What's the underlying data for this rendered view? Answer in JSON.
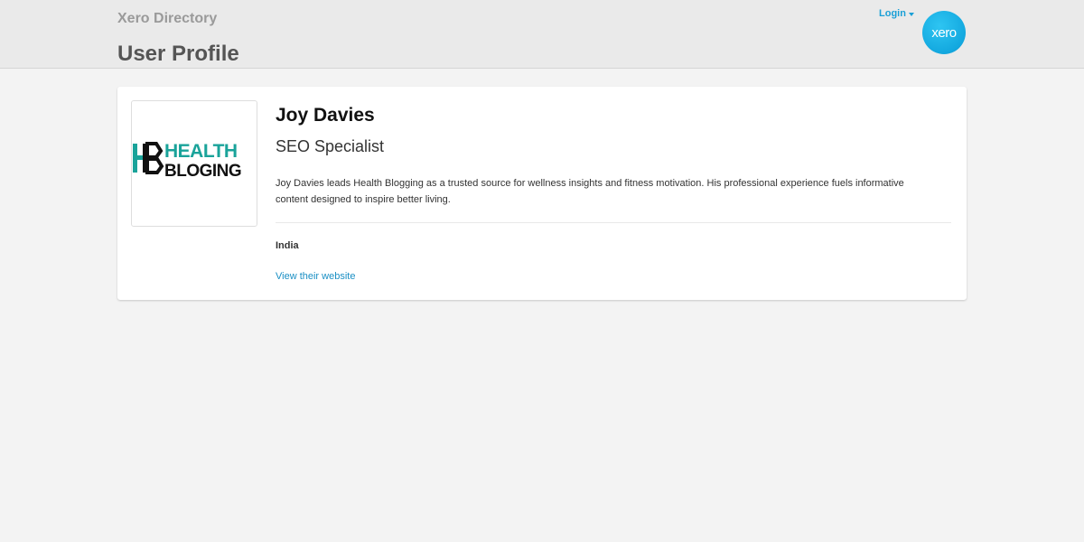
{
  "header": {
    "brand": "Xero Directory",
    "page_title": "User Profile",
    "login_label": "Login",
    "logo_text": "xero"
  },
  "profile": {
    "logo": {
      "line1": "HEALTH",
      "line2": "BLOGING",
      "mark": "HB",
      "colors": {
        "teal": "#1aa39a",
        "black": "#111111"
      }
    },
    "name": "Joy Davies",
    "role": "SEO Specialist",
    "bio": "Joy Davies leads Health Blogging as a trusted source for wellness insights and fitness motivation. His professional experience fuels informative content designed to inspire better living.",
    "country": "India",
    "website_link": "View their website"
  },
  "colors": {
    "accent": "#1a9fd6",
    "link": "#1a8fc4",
    "header_bg": "#eaeaea",
    "page_bg": "#f3f3f3"
  }
}
